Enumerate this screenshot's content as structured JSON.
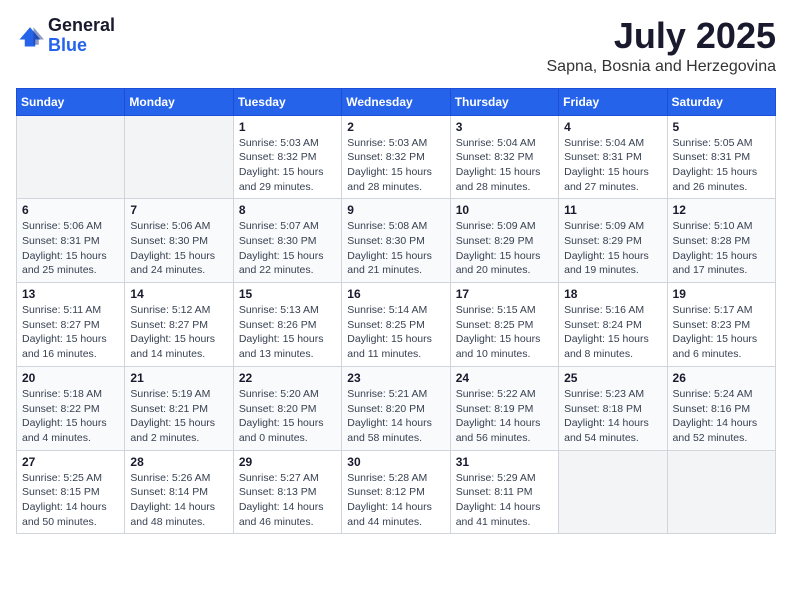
{
  "logo": {
    "general": "General",
    "blue": "Blue"
  },
  "title": "July 2025",
  "location": "Sapna, Bosnia and Herzegovina",
  "weekdays": [
    "Sunday",
    "Monday",
    "Tuesday",
    "Wednesday",
    "Thursday",
    "Friday",
    "Saturday"
  ],
  "weeks": [
    [
      {
        "day": "",
        "info": ""
      },
      {
        "day": "",
        "info": ""
      },
      {
        "day": "1",
        "info": "Sunrise: 5:03 AM\nSunset: 8:32 PM\nDaylight: 15 hours and 29 minutes."
      },
      {
        "day": "2",
        "info": "Sunrise: 5:03 AM\nSunset: 8:32 PM\nDaylight: 15 hours and 28 minutes."
      },
      {
        "day": "3",
        "info": "Sunrise: 5:04 AM\nSunset: 8:32 PM\nDaylight: 15 hours and 28 minutes."
      },
      {
        "day": "4",
        "info": "Sunrise: 5:04 AM\nSunset: 8:31 PM\nDaylight: 15 hours and 27 minutes."
      },
      {
        "day": "5",
        "info": "Sunrise: 5:05 AM\nSunset: 8:31 PM\nDaylight: 15 hours and 26 minutes."
      }
    ],
    [
      {
        "day": "6",
        "info": "Sunrise: 5:06 AM\nSunset: 8:31 PM\nDaylight: 15 hours and 25 minutes."
      },
      {
        "day": "7",
        "info": "Sunrise: 5:06 AM\nSunset: 8:30 PM\nDaylight: 15 hours and 24 minutes."
      },
      {
        "day": "8",
        "info": "Sunrise: 5:07 AM\nSunset: 8:30 PM\nDaylight: 15 hours and 22 minutes."
      },
      {
        "day": "9",
        "info": "Sunrise: 5:08 AM\nSunset: 8:30 PM\nDaylight: 15 hours and 21 minutes."
      },
      {
        "day": "10",
        "info": "Sunrise: 5:09 AM\nSunset: 8:29 PM\nDaylight: 15 hours and 20 minutes."
      },
      {
        "day": "11",
        "info": "Sunrise: 5:09 AM\nSunset: 8:29 PM\nDaylight: 15 hours and 19 minutes."
      },
      {
        "day": "12",
        "info": "Sunrise: 5:10 AM\nSunset: 8:28 PM\nDaylight: 15 hours and 17 minutes."
      }
    ],
    [
      {
        "day": "13",
        "info": "Sunrise: 5:11 AM\nSunset: 8:27 PM\nDaylight: 15 hours and 16 minutes."
      },
      {
        "day": "14",
        "info": "Sunrise: 5:12 AM\nSunset: 8:27 PM\nDaylight: 15 hours and 14 minutes."
      },
      {
        "day": "15",
        "info": "Sunrise: 5:13 AM\nSunset: 8:26 PM\nDaylight: 15 hours and 13 minutes."
      },
      {
        "day": "16",
        "info": "Sunrise: 5:14 AM\nSunset: 8:25 PM\nDaylight: 15 hours and 11 minutes."
      },
      {
        "day": "17",
        "info": "Sunrise: 5:15 AM\nSunset: 8:25 PM\nDaylight: 15 hours and 10 minutes."
      },
      {
        "day": "18",
        "info": "Sunrise: 5:16 AM\nSunset: 8:24 PM\nDaylight: 15 hours and 8 minutes."
      },
      {
        "day": "19",
        "info": "Sunrise: 5:17 AM\nSunset: 8:23 PM\nDaylight: 15 hours and 6 minutes."
      }
    ],
    [
      {
        "day": "20",
        "info": "Sunrise: 5:18 AM\nSunset: 8:22 PM\nDaylight: 15 hours and 4 minutes."
      },
      {
        "day": "21",
        "info": "Sunrise: 5:19 AM\nSunset: 8:21 PM\nDaylight: 15 hours and 2 minutes."
      },
      {
        "day": "22",
        "info": "Sunrise: 5:20 AM\nSunset: 8:20 PM\nDaylight: 15 hours and 0 minutes."
      },
      {
        "day": "23",
        "info": "Sunrise: 5:21 AM\nSunset: 8:20 PM\nDaylight: 14 hours and 58 minutes."
      },
      {
        "day": "24",
        "info": "Sunrise: 5:22 AM\nSunset: 8:19 PM\nDaylight: 14 hours and 56 minutes."
      },
      {
        "day": "25",
        "info": "Sunrise: 5:23 AM\nSunset: 8:18 PM\nDaylight: 14 hours and 54 minutes."
      },
      {
        "day": "26",
        "info": "Sunrise: 5:24 AM\nSunset: 8:16 PM\nDaylight: 14 hours and 52 minutes."
      }
    ],
    [
      {
        "day": "27",
        "info": "Sunrise: 5:25 AM\nSunset: 8:15 PM\nDaylight: 14 hours and 50 minutes."
      },
      {
        "day": "28",
        "info": "Sunrise: 5:26 AM\nSunset: 8:14 PM\nDaylight: 14 hours and 48 minutes."
      },
      {
        "day": "29",
        "info": "Sunrise: 5:27 AM\nSunset: 8:13 PM\nDaylight: 14 hours and 46 minutes."
      },
      {
        "day": "30",
        "info": "Sunrise: 5:28 AM\nSunset: 8:12 PM\nDaylight: 14 hours and 44 minutes."
      },
      {
        "day": "31",
        "info": "Sunrise: 5:29 AM\nSunset: 8:11 PM\nDaylight: 14 hours and 41 minutes."
      },
      {
        "day": "",
        "info": ""
      },
      {
        "day": "",
        "info": ""
      }
    ]
  ]
}
